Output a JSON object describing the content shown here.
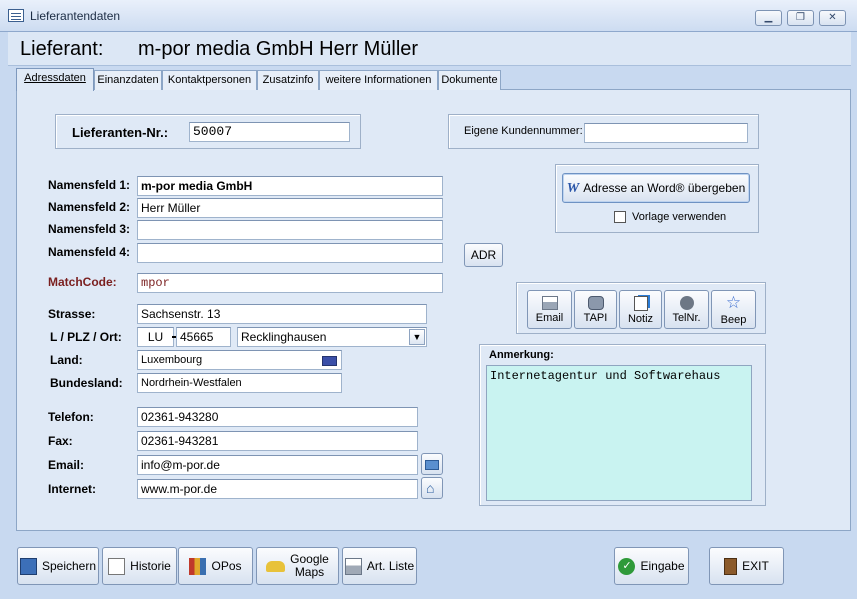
{
  "window": {
    "title": "Lieferantendaten"
  },
  "header": {
    "label": "Lieferant:",
    "value": "m-por media GmbH Herr Müller"
  },
  "tabs": [
    "Adressdaten",
    "Einanzdaten",
    "Kontaktpersonen",
    "Zusatzinfo",
    "weitere Informationen",
    "Dokumente"
  ],
  "form": {
    "lieferanten_nr_label": "Lieferanten-Nr.:",
    "lieferanten_nr": "50007",
    "kundennummer_label": "Eigene Kundennummer:",
    "kundennummer": "",
    "namensfeld1_label": "Namensfeld 1:",
    "namensfeld1": "m-por media GmbH",
    "namensfeld2_label": "Namensfeld 2:",
    "namensfeld2": "Herr Müller",
    "namensfeld3_label": "Namensfeld 3:",
    "namensfeld3": "",
    "namensfeld4_label": "Namensfeld 4:",
    "namensfeld4": "",
    "matchcode_label": "MatchCode:",
    "matchcode": "mpor",
    "strasse_label": "Strasse:",
    "strasse": "Sachsenstr. 13",
    "plz_label": "L / PLZ / Ort:",
    "land_code": "LU",
    "plz": "45665",
    "ort": "Recklinghausen",
    "land_label": "Land:",
    "land": "Luxembourg",
    "bundesland_label": "Bundesland:",
    "bundesland": "Nordrhein-Westfalen",
    "telefon_label": "Telefon:",
    "telefon": "02361-943280",
    "fax_label": "Fax:",
    "fax": "02361-943281",
    "email_label": "Email:",
    "email": "info@m-por.de",
    "internet_label": "Internet:",
    "internet": "www.m-por.de"
  },
  "word": {
    "button": "Adresse an Word® übergeben",
    "checkbox_label": "Vorlage verwenden"
  },
  "adr_button": "ADR",
  "actions": [
    "Email",
    "TAPI",
    "Notiz",
    "TelNr.",
    "Beep"
  ],
  "anmerkung": {
    "label": "Anmerkung:",
    "text": "Internetagentur und Softwarehaus"
  },
  "bottom": {
    "speichern": "Speichern",
    "historie": "Historie",
    "opos": "OPos",
    "google_maps_1": "Google",
    "google_maps_2": "Maps",
    "art_liste": "Art. Liste",
    "eingabe": "Eingabe",
    "exit": "EXIT"
  }
}
